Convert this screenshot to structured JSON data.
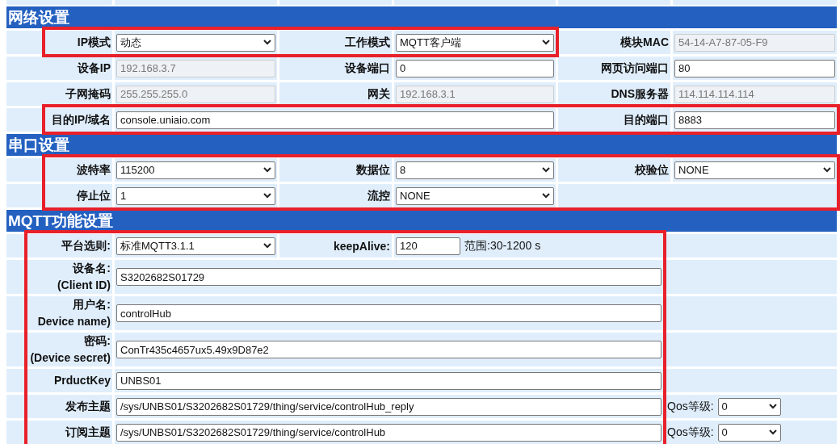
{
  "sections": [
    {
      "title": "网络设置",
      "kind": "grid6",
      "rows": [
        [
          {
            "label": "IP模式",
            "highlighted": true,
            "field": {
              "kind": "select",
              "value": "动态",
              "disabled": false
            }
          },
          {
            "label": "工作模式",
            "highlighted": true,
            "field": {
              "kind": "select",
              "value": "MQTT客户端",
              "disabled": false
            }
          },
          {
            "label": "模块MAC",
            "field": {
              "kind": "input",
              "value": "54-14-A7-87-05-F9",
              "disabled": true
            }
          }
        ],
        [
          {
            "label": "设备IP",
            "field": {
              "kind": "input",
              "value": "192.168.3.7",
              "disabled": true
            }
          },
          {
            "label": "设备端口",
            "field": {
              "kind": "input",
              "value": "0",
              "disabled": false
            }
          },
          {
            "label": "网页访问端口",
            "field": {
              "kind": "input",
              "value": "80",
              "disabled": false
            }
          }
        ],
        [
          {
            "label": "子网掩码",
            "field": {
              "kind": "input",
              "value": "255.255.255.0",
              "disabled": true
            }
          },
          {
            "label": "网关",
            "field": {
              "kind": "input",
              "value": "192.168.3.1",
              "disabled": true
            }
          },
          {
            "label": "DNS服务器",
            "field": {
              "kind": "input",
              "value": "114.114.114.114",
              "disabled": true
            }
          }
        ],
        [
          {
            "label": "目的IP/域名",
            "highlighted": true,
            "colspan": 3,
            "field": {
              "kind": "input",
              "value": "console.uniaio.com",
              "disabled": false
            }
          },
          {
            "label": "目的端口",
            "highlighted": true,
            "field": {
              "kind": "input",
              "value": "8883",
              "disabled": false
            }
          }
        ]
      ]
    },
    {
      "title": "串口设置",
      "kind": "grid6",
      "rows": [
        [
          {
            "label": "波特率",
            "highlighted": true,
            "field": {
              "kind": "select",
              "value": "115200",
              "disabled": false
            }
          },
          {
            "label": "数据位",
            "highlighted": true,
            "field": {
              "kind": "select",
              "value": "8",
              "disabled": false
            }
          },
          {
            "label": "校验位",
            "highlighted": true,
            "field": {
              "kind": "select",
              "value": "NONE",
              "disabled": false
            }
          }
        ],
        [
          {
            "label": "停止位",
            "highlighted": true,
            "field": {
              "kind": "select",
              "value": "1",
              "disabled": false
            }
          },
          {
            "label": "流控",
            "highlighted": true,
            "field": {
              "kind": "select",
              "value": "NONE",
              "disabled": false
            }
          }
        ]
      ]
    },
    {
      "title": "MQTT功能设置",
      "kind": "mqtt",
      "rows": [
        {
          "kind": "keepalive",
          "highlighted": true,
          "label": "平台选则:",
          "field": {
            "kind": "select",
            "value": "标准MQTT3.1.1"
          },
          "label_2": "keepAlive:",
          "field_2": {
            "kind": "input",
            "value": "120"
          },
          "note": "范围:30-1200 s"
        },
        {
          "kind": "text",
          "highlighted": true,
          "label": "设备名:\n(Client ID)",
          "field": {
            "kind": "input",
            "value": "S3202682S01729"
          }
        },
        {
          "kind": "text",
          "highlighted": true,
          "label": "用户名:\nDevice name)",
          "field": {
            "kind": "input",
            "value": "controlHub"
          }
        },
        {
          "kind": "text",
          "highlighted": true,
          "label": "密码:\n(Device secret)",
          "field": {
            "kind": "input",
            "value": "ConTr435c4657ux5.49x9D87e2"
          }
        },
        {
          "kind": "text",
          "highlighted": true,
          "label": "PrductKey",
          "field": {
            "kind": "input",
            "value": "UNBS01"
          }
        },
        {
          "kind": "topic",
          "highlighted": true,
          "label": "发布主题",
          "field": {
            "kind": "input",
            "value": "/sys/UNBS01/S3202682S01729/thing/service/controlHub_reply"
          },
          "qos_label": "Qos等级:",
          "qos": {
            "kind": "select",
            "value": "0"
          }
        },
        {
          "kind": "topic",
          "highlighted": true,
          "label": "订阅主题",
          "field": {
            "kind": "input",
            "value": "/sys/UNBS01/S3202682S01729/thing/service/controlHub"
          },
          "qos_label": "Qos等级:",
          "qos": {
            "kind": "select",
            "value": "0"
          }
        }
      ]
    }
  ]
}
